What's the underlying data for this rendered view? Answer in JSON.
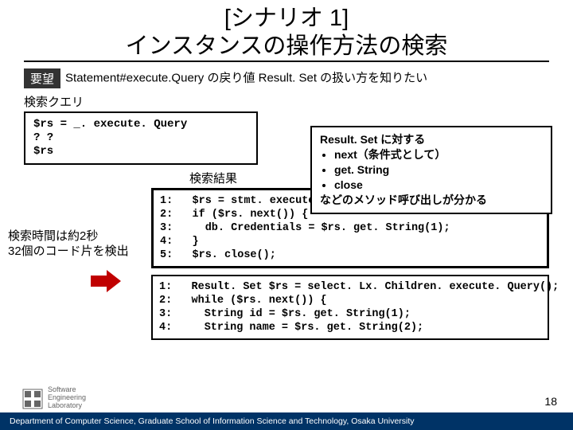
{
  "title_line1": "[シナリオ 1]",
  "title_line2": "インスタンスの操作方法の検索",
  "badge": "要望",
  "desire": "Statement#execute.Query の戻り値 Result. Set の扱い方を知りたい",
  "query_label": "検索クエリ",
  "query_text": "$rs = _. execute. Query\n? ?\n$rs",
  "results_label": "検索結果",
  "meta_line1": "検索時間は約2秒",
  "meta_line2": "32個のコード片を検出",
  "explain_line1": "Result. Set に対する",
  "explain_item1": "next（条件式として）",
  "explain_item2": "get. String",
  "explain_item3": "close",
  "explain_line2": "などのメソッド呼び出しが分かる",
  "code1": "1:   $rs = stmt. execute. Query();\n2:   if ($rs. next()) {\n3:     db. Credentials = $rs. get. String(1);\n4:   }\n5:   $rs. close();",
  "code2": "1:   Result. Set $rs = select. Lx. Children. execute. Query();\n2:   while ($rs. next()) {\n3:     String id = $rs. get. String(1);\n4:     String name = $rs. get. String(2);",
  "page": "18",
  "footer": "Department of Computer Science, Graduate School of Information Science and Technology, Osaka University",
  "logo_line1": "Software",
  "logo_line2": "Engineering",
  "logo_line3": "Laboratory"
}
